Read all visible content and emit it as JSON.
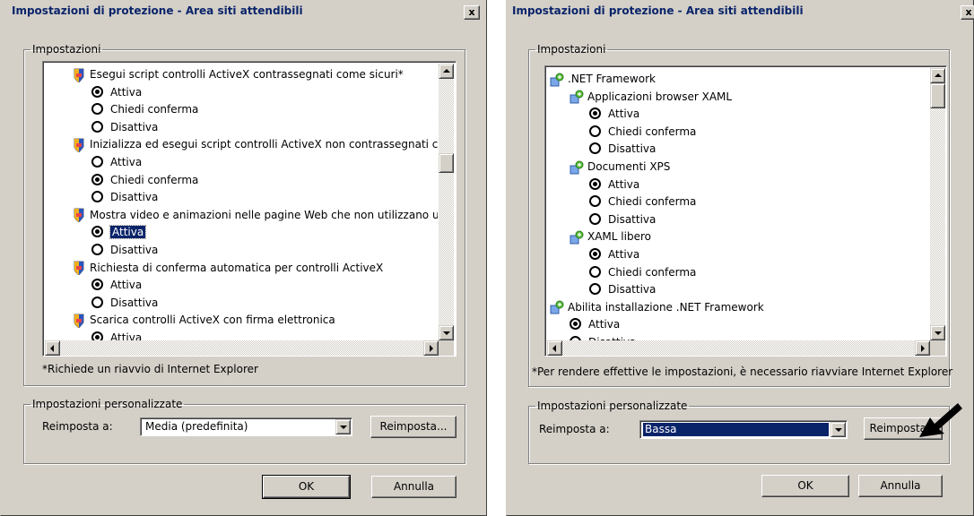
{
  "left_dialog": {
    "title": "Impostazioni di protezione - Area siti attendibili",
    "close_label": "x",
    "settings_group_label": "Impostazioni",
    "settings_rows": [
      {
        "kind": "header",
        "icon": "shield-setting-icon",
        "label": "Esegui script controlli ActiveX contrassegnati come sicuri*"
      },
      {
        "kind": "option",
        "label": "Attiva",
        "checked": true
      },
      {
        "kind": "option",
        "label": "Chiedi conferma",
        "checked": false
      },
      {
        "kind": "option",
        "label": "Disattiva",
        "checked": false
      },
      {
        "kind": "header",
        "icon": "shield-setting-icon",
        "label": "Inizializza ed esegui script controlli ActiveX non contrassegnati co"
      },
      {
        "kind": "option",
        "label": "Attiva",
        "checked": false
      },
      {
        "kind": "option",
        "label": "Chiedi conferma",
        "checked": true
      },
      {
        "kind": "option",
        "label": "Disattiva",
        "checked": false
      },
      {
        "kind": "header",
        "icon": "shield-setting-icon",
        "label": "Mostra video e animazioni nelle pagine Web che non utilizzano un"
      },
      {
        "kind": "option",
        "label": "Attiva",
        "checked": true,
        "focused": true
      },
      {
        "kind": "option",
        "label": "Disattiva",
        "checked": false
      },
      {
        "kind": "header",
        "icon": "shield-setting-icon",
        "label": "Richiesta di conferma automatica per controlli ActiveX"
      },
      {
        "kind": "option",
        "label": "Attiva",
        "checked": true
      },
      {
        "kind": "option",
        "label": "Disattiva",
        "checked": false
      },
      {
        "kind": "header",
        "icon": "shield-setting-icon",
        "label": "Scarica controlli ActiveX con firma elettronica"
      },
      {
        "kind": "option",
        "label": "Attiva",
        "checked": true
      }
    ],
    "restart_note": "*Richiede un riavvio di Internet Explorer",
    "custom_group_label": "Impostazioni personalizzate",
    "reset_to_label": "Reimposta a:",
    "reset_level_value": "Media (predefinita)",
    "reset_button_label": "Reimposta...",
    "ok_label": "OK",
    "cancel_label": "Annulla"
  },
  "right_dialog": {
    "title": "Impostazioni di protezione - Area siti attendibili",
    "close_label": "x",
    "settings_group_label": "Impostazioni",
    "settings_rows": [
      {
        "kind": "header",
        "indent": 0,
        "icon": "net-framework-icon",
        "label": ".NET Framework"
      },
      {
        "kind": "header",
        "indent": 1,
        "icon": "net-framework-icon",
        "label": "Applicazioni browser XAML"
      },
      {
        "kind": "option",
        "indent": 2,
        "label": "Attiva",
        "checked": true
      },
      {
        "kind": "option",
        "indent": 2,
        "label": "Chiedi conferma",
        "checked": false
      },
      {
        "kind": "option",
        "indent": 2,
        "label": "Disattiva",
        "checked": false
      },
      {
        "kind": "header",
        "indent": 1,
        "icon": "net-framework-icon",
        "label": "Documenti XPS"
      },
      {
        "kind": "option",
        "indent": 2,
        "label": "Attiva",
        "checked": true
      },
      {
        "kind": "option",
        "indent": 2,
        "label": "Chiedi conferma",
        "checked": false
      },
      {
        "kind": "option",
        "indent": 2,
        "label": "Disattiva",
        "checked": false
      },
      {
        "kind": "header",
        "indent": 1,
        "icon": "net-framework-icon",
        "label": "XAML libero"
      },
      {
        "kind": "option",
        "indent": 2,
        "label": "Attiva",
        "checked": true
      },
      {
        "kind": "option",
        "indent": 2,
        "label": "Chiedi conferma",
        "checked": false
      },
      {
        "kind": "option",
        "indent": 2,
        "label": "Disattiva",
        "checked": false
      },
      {
        "kind": "header",
        "indent": 0,
        "icon": "net-framework-icon",
        "label": "Abilita installazione .NET Framework"
      },
      {
        "kind": "option",
        "indent": 1,
        "label": "Attiva",
        "checked": true
      },
      {
        "kind": "option",
        "indent": 1,
        "label": "Disattiva",
        "checked": false
      }
    ],
    "restart_note": "*Per rendere effettive le impostazioni, è necessario riavviare Internet Explorer",
    "custom_group_label": "Impostazioni personalizzate",
    "reset_to_label": "Reimposta a:",
    "reset_level_value": "Bassa",
    "reset_button_label": "Reimposta...",
    "ok_label": "OK",
    "cancel_label": "Annulla"
  }
}
